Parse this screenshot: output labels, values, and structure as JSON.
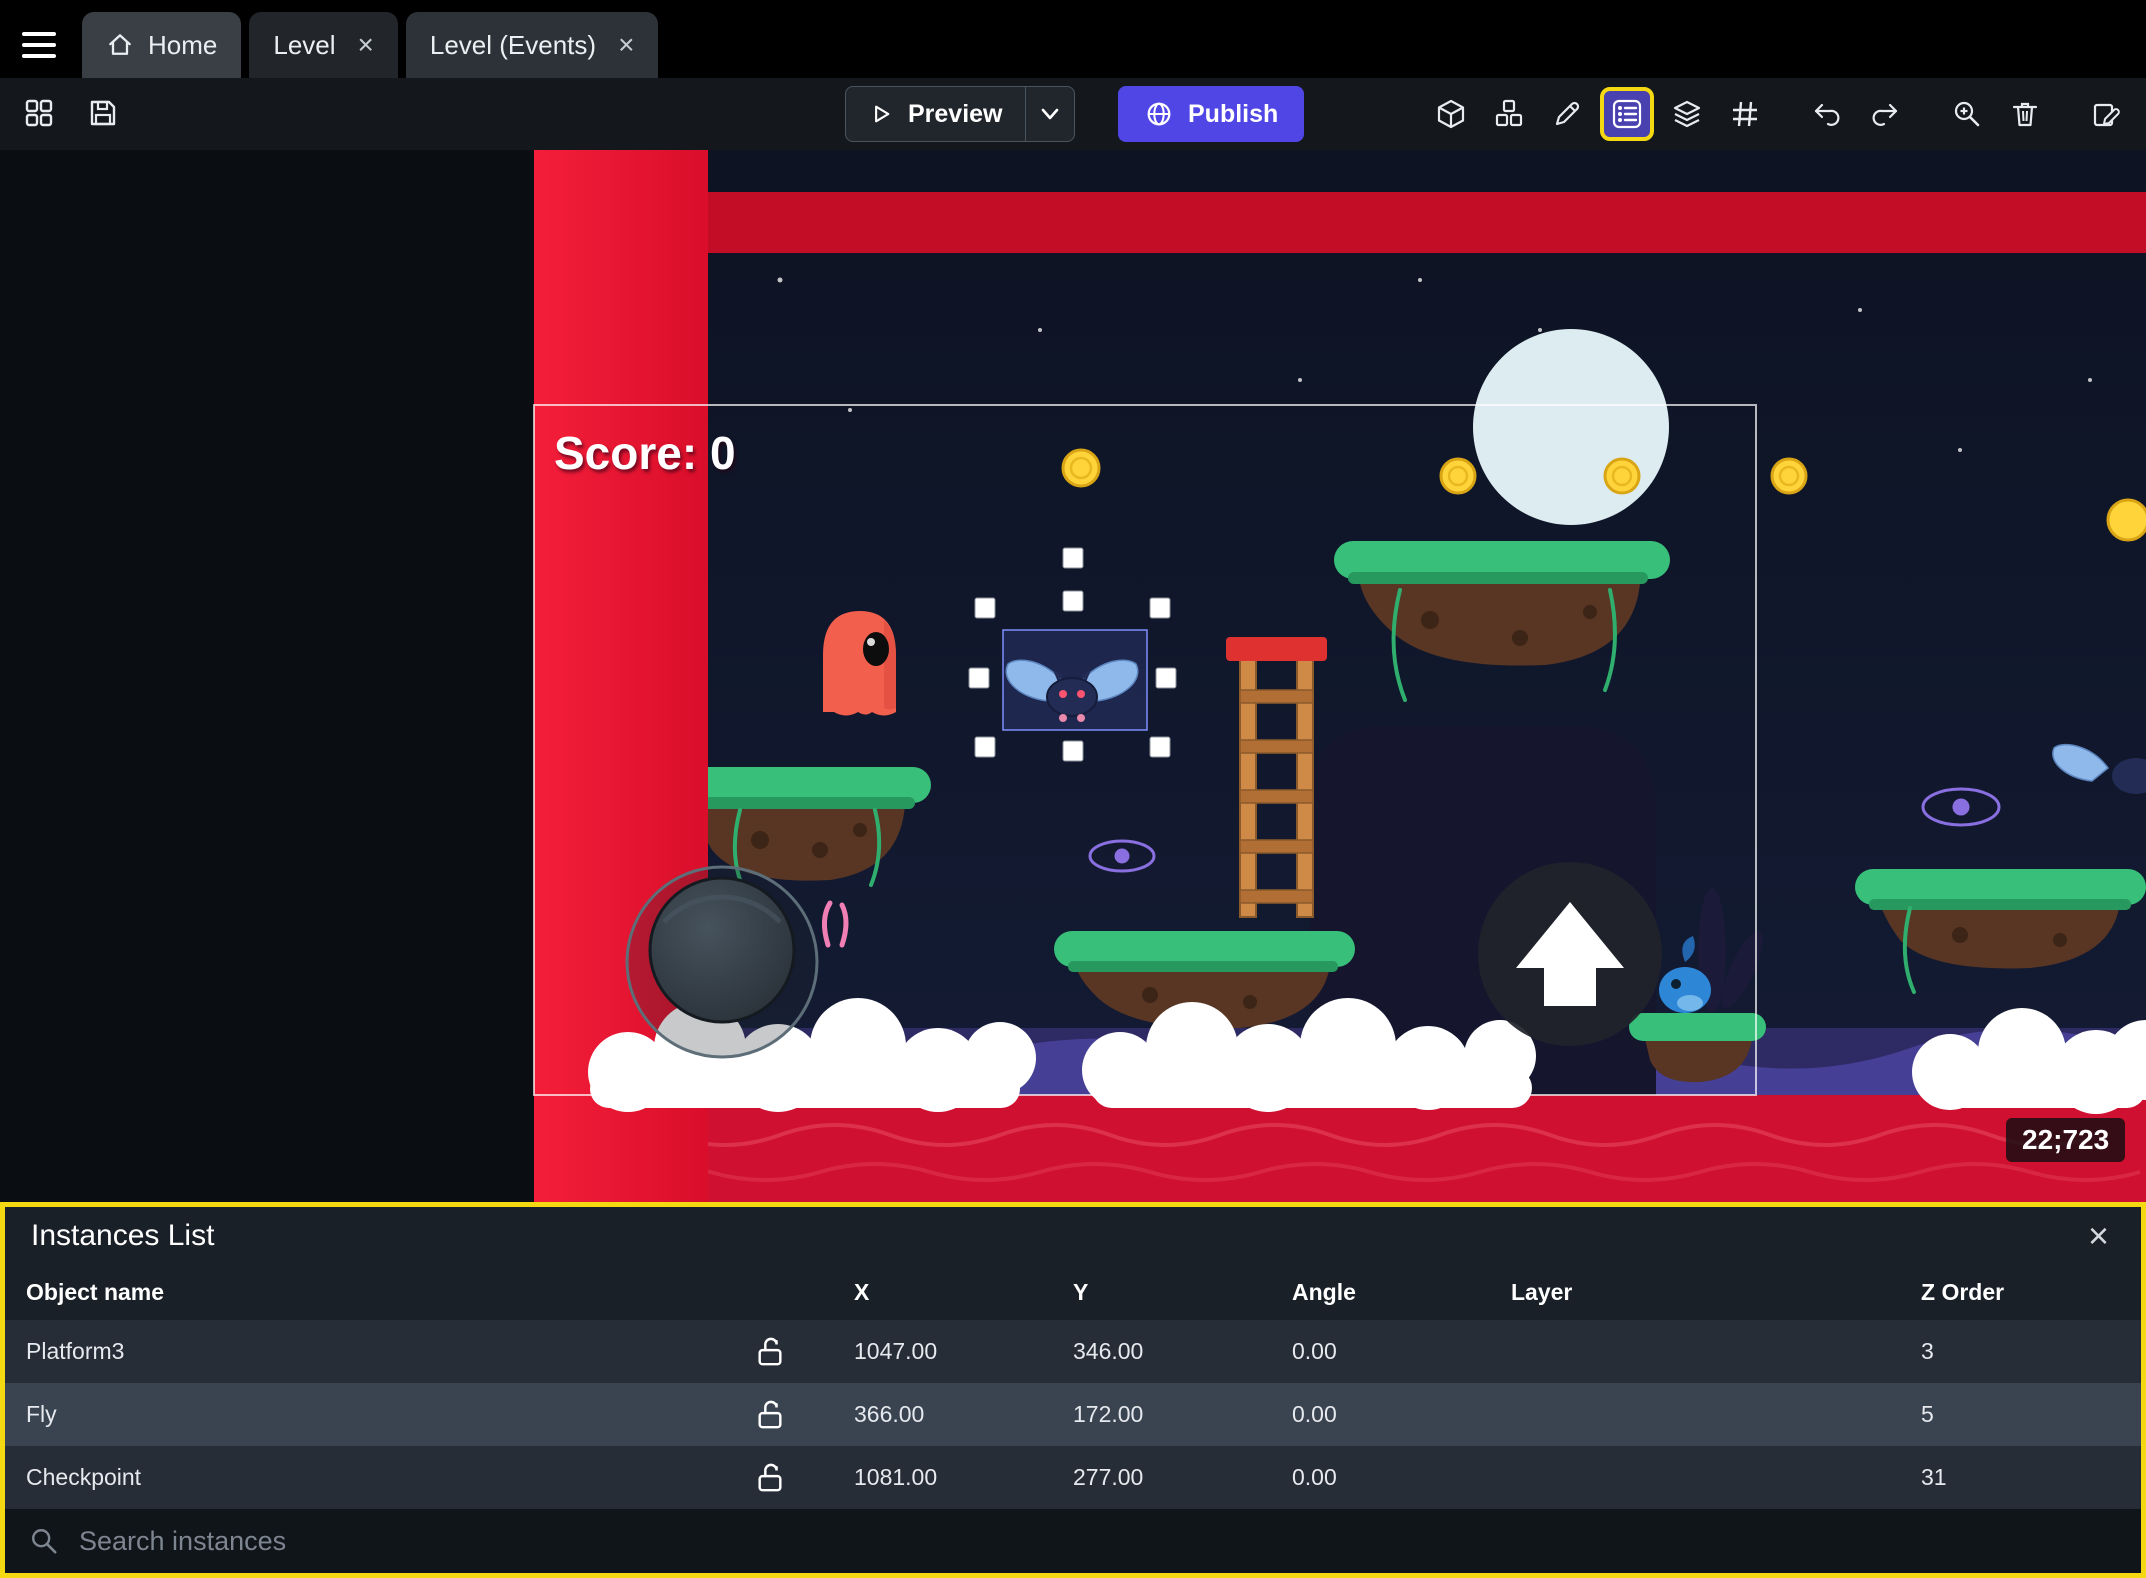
{
  "tabs": {
    "home": "Home",
    "level": "Level",
    "level_events": "Level (Events)"
  },
  "toolbar": {
    "preview_label": "Preview",
    "publish_label": "Publish"
  },
  "canvas": {
    "score_text": "Score: 0",
    "coords_badge": "22;723"
  },
  "instances_panel": {
    "title": "Instances List",
    "columns": [
      "Object name",
      "X",
      "Y",
      "Angle",
      "Layer",
      "Z Order"
    ],
    "rows": [
      {
        "name": "Platform3",
        "x": "1047.00",
        "y": "346.00",
        "angle": "0.00",
        "layer": "",
        "z": "3"
      },
      {
        "name": "Fly",
        "x": "366.00",
        "y": "172.00",
        "angle": "0.00",
        "layer": "",
        "z": "5"
      },
      {
        "name": "Checkpoint",
        "x": "1081.00",
        "y": "277.00",
        "angle": "0.00",
        "layer": "",
        "z": "31"
      }
    ],
    "search_placeholder": "Search instances"
  },
  "colors": {
    "publish_button": "#4f46e5",
    "highlight_yellow": "#f4d812",
    "red_wall": "#e8122f"
  }
}
